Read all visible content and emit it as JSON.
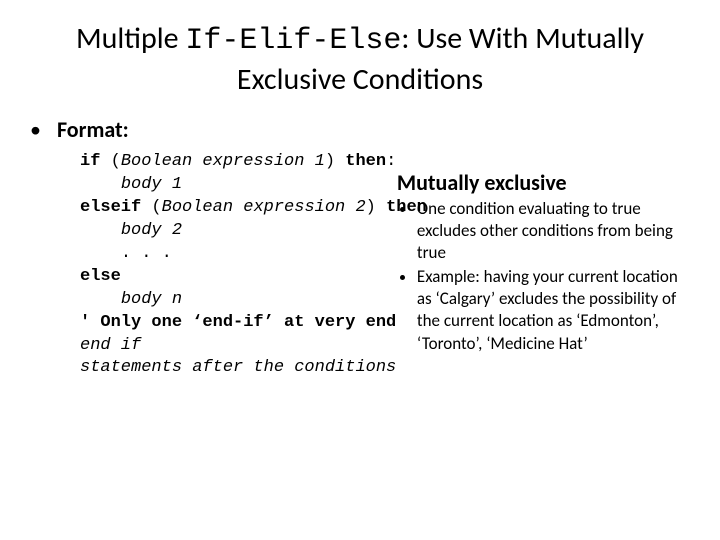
{
  "title_pre": "Multiple ",
  "title_mono": "If-Elif-Else",
  "title_post": ": Use With Mutually Exclusive Conditions",
  "format_label": "Format:",
  "code": {
    "l1a": "if",
    "l1b": " (",
    "l1c": "Boolean expression 1",
    "l1d": ") ",
    "l1e": "then",
    "l1f": ":",
    "l2": "body 1",
    "l3a": "elseif",
    "l3b": " (",
    "l3c": "Boolean expression 2",
    "l3d": ") ",
    "l3e": "then",
    "l4": "body 2",
    "l5": ". . .",
    "l6": "else",
    "l7": "body n",
    "l8": "' Only one ‘end-if’ at very end",
    "l9": "end if",
    "l10": "statements after the conditions"
  },
  "side_heading": "Mutually exclusive",
  "side_items": [
    "One condition evaluating to true excludes other conditions from being true",
    "Example: having your current location as ‘Calgary’ excludes the possibility of the current location as ‘Edmonton’, ‘Toronto’, ‘Medicine Hat’"
  ]
}
